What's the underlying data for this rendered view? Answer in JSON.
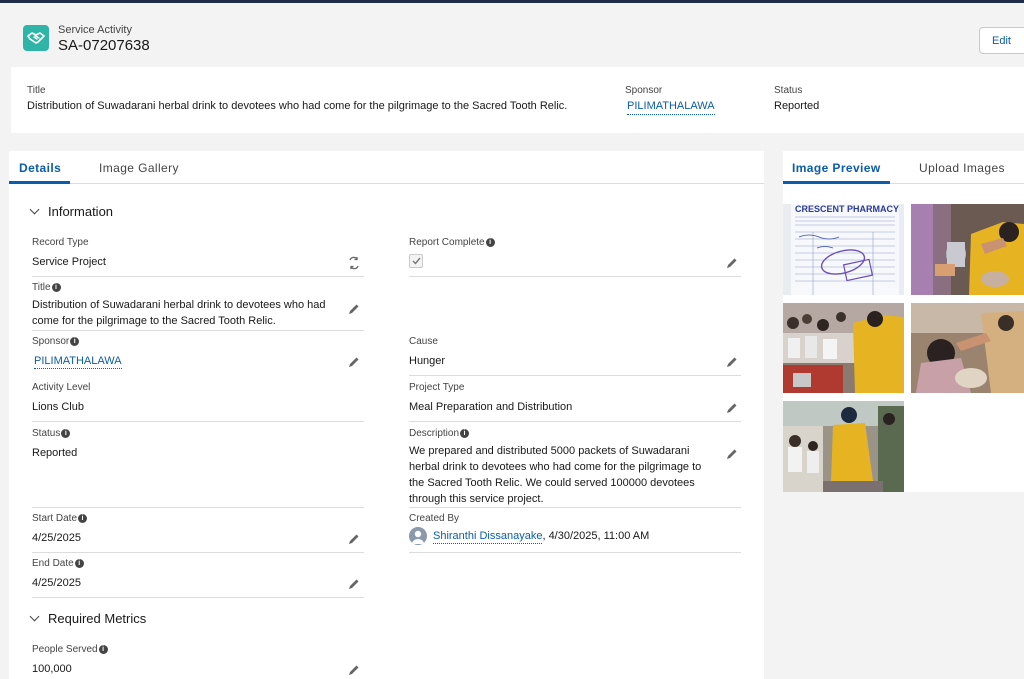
{
  "header": {
    "object_type": "Service Activity",
    "record_id": "SA-07207638",
    "edit_label": "Edit"
  },
  "highlights": {
    "title_label": "Title",
    "title_value": "Distribution of Suwadarani herbal drink to devotees who had come for the pilgrimage to the Sacred Tooth Relic.",
    "sponsor_label": "Sponsor",
    "sponsor_value": "PILIMATHALAWA",
    "status_label": "Status",
    "status_value": "Reported"
  },
  "main_tabs": [
    {
      "label": "Details",
      "active": true
    },
    {
      "label": "Image Gallery",
      "active": false
    }
  ],
  "side_tabs": [
    {
      "label": "Image Preview",
      "active": true
    },
    {
      "label": "Upload Images",
      "active": false
    }
  ],
  "sections": {
    "information": "Information",
    "required_metrics": "Required Metrics"
  },
  "fields": {
    "record_type": {
      "label": "Record Type",
      "value": "Service Project"
    },
    "report_complete": {
      "label": "Report Complete",
      "checked": true
    },
    "title": {
      "label": "Title",
      "value": "Distribution of Suwadarani herbal drink to devotees who had come for the pilgrimage to the Sacred Tooth Relic."
    },
    "sponsor": {
      "label": "Sponsor",
      "value": "PILIMATHALAWA"
    },
    "cause": {
      "label": "Cause",
      "value": "Hunger"
    },
    "activity_level": {
      "label": "Activity Level",
      "value": "Lions Club"
    },
    "project_type": {
      "label": "Project Type",
      "value": "Meal Preparation and Distribution"
    },
    "status": {
      "label": "Status",
      "value": "Reported"
    },
    "description": {
      "label": "Description",
      "value": "We prepared and distributed 5000 packets of Suwadarani herbal drink to devotees who had come for the pilgrimage to the Sacred Tooth Relic. We could served 100000 devotees through this service project."
    },
    "start_date": {
      "label": "Start Date",
      "value": "4/25/2025"
    },
    "end_date": {
      "label": "End Date",
      "value": "4/25/2025"
    },
    "created_by": {
      "label": "Created By",
      "user": "Shiranthi Dissanayake",
      "date": ", 4/30/2025, 11:00 AM"
    },
    "people_served": {
      "label": "People Served",
      "value": "100,000"
    }
  },
  "gallery": {
    "receipt_heading": "CRESCENT PHARMACY",
    "images": [
      {
        "name": "receipt-photo"
      },
      {
        "name": "volunteers-pouring-drink-photo"
      },
      {
        "name": "crowd-distribution-photo"
      },
      {
        "name": "devotees-receiving-photo"
      },
      {
        "name": "volunteer-yellow-vest-photo"
      }
    ]
  },
  "colors": {
    "accent": "#0b5cab",
    "icon_bg": "#2fb5a7",
    "vest_yellow": "#e6b422"
  }
}
